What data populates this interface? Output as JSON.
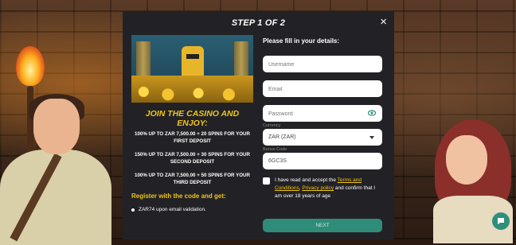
{
  "modal": {
    "step_title": "STEP 1 OF 2",
    "close_label": "×"
  },
  "promo": {
    "heading": "JOIN THE CASINO AND ENJOY:",
    "bonuses": [
      {
        "line1": "100% UP TO ZAR 7,500.00 + 20 SPINS FOR YOUR",
        "line2": "FIRST DEPOSIT"
      },
      {
        "line1": "150% UP TO ZAR 7,500.00 + 30 SPINS FOR YOUR",
        "line2": "SECOND DEPOSIT"
      },
      {
        "line1": "100% UP TO ZAR 7,500.00 + 50 SPINS FOR YOUR",
        "line2": "THIRD DEPOSIT"
      }
    ],
    "register_heading": "Register with the code and get:",
    "reward": "ZAR74 upon email validation."
  },
  "form": {
    "intro": "Please fill in your details:",
    "username_placeholder": "Username",
    "email_placeholder": "Email",
    "password_placeholder": "Password",
    "currency_caption": "Currency",
    "currency_value": "ZAR (ZAR)",
    "bonus_caption": "Bonus Code",
    "bonus_value": "6GC3S",
    "terms_pre": "I have read and accept the ",
    "terms_link": "Terms and Conditions",
    "terms_mid": ", ",
    "privacy_link": "Privacy policy",
    "terms_post": " and confirm that I am over 18 years of age",
    "next_label": "NEXT"
  },
  "colors": {
    "accent_yellow": "#f0c419",
    "button_green": "#2e8c78",
    "modal_bg": "#222226"
  }
}
